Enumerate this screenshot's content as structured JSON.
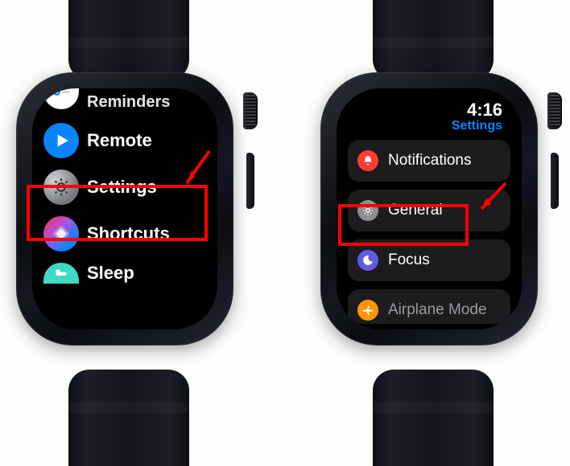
{
  "watch_left": {
    "apps": {
      "reminders": "Reminders",
      "remote": "Remote",
      "settings": "Settings",
      "shortcuts": "Shortcuts",
      "sleep": "Sleep"
    }
  },
  "watch_right": {
    "time": "4:16",
    "title": "Settings",
    "rows": {
      "notifications": "Notifications",
      "general": "General",
      "focus": "Focus",
      "airplane": "Airplane Mode"
    }
  },
  "highlights": [
    "settings",
    "general"
  ]
}
